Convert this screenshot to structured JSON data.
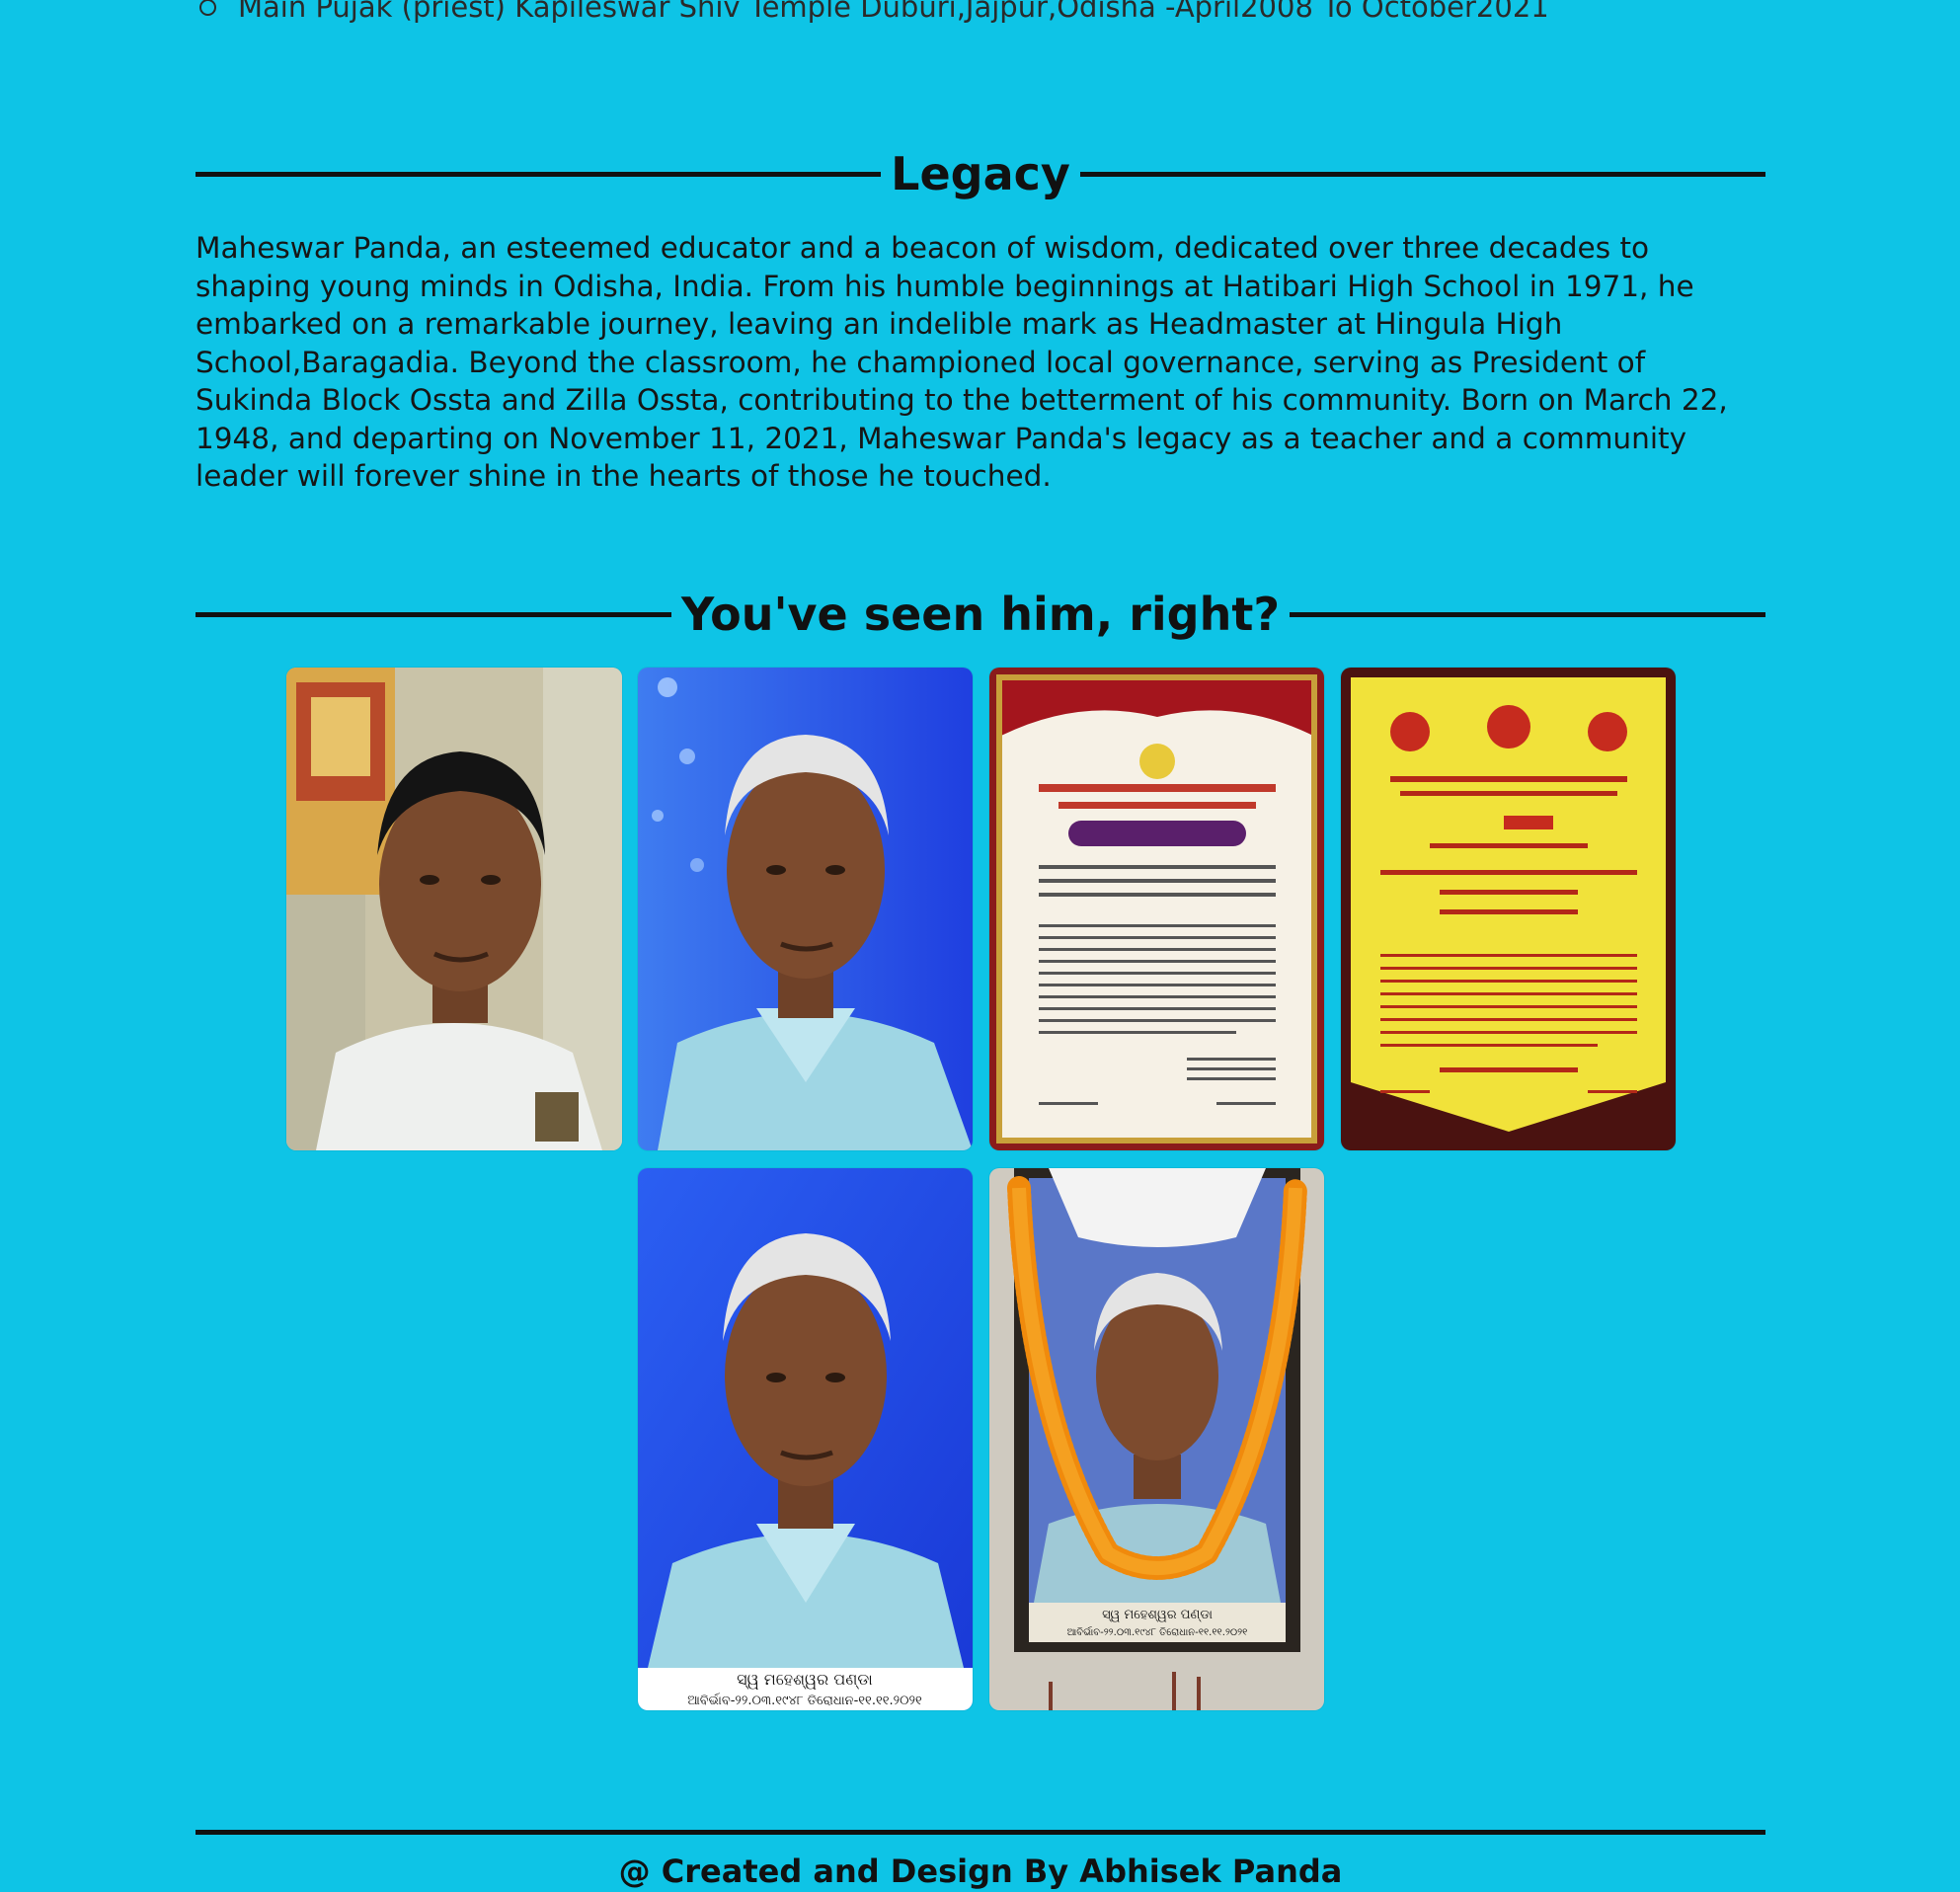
{
  "positions": {
    "last_item": "Main Pujak (priest) Kapileswar Shiv Temple Duburi,Jajpur,Odisha -April2008 To October2021"
  },
  "legacy": {
    "heading": "Legacy",
    "text": "Maheswar Panda, an esteemed educator and a beacon of wisdom, dedicated over three decades to shaping young minds in Odisha, India. From his humble beginnings at Hatibari High School in 1971, he embarked on a remarkable journey, leaving an indelible mark as Headmaster at Hingula High School,Baragadia. Beyond the classroom, he championed local governance, serving as President of Sukinda Block Ossta and Zilla Ossta, contributing to the betterment of his community. Born on March 22, 1948, and departing on November 11, 2021, Maheswar Panda's legacy as a teacher and a community leader will forever shine in the hearts of those he touched."
  },
  "gallery": {
    "heading": "You've seen him, right?",
    "photos": [
      {
        "name": "photo-portrait-indoor"
      },
      {
        "name": "photo-portrait-blue-bg"
      },
      {
        "name": "photo-felicitation-certificate"
      },
      {
        "name": "photo-brahmin-samaj-certificate"
      },
      {
        "name": "photo-memorial-portrait",
        "caption_line1": "ସ୍ୱ ମହେଶ୍ୱର ପଣ୍ଡା",
        "caption_line2": "ଆବିର୍ଭାବ-୨୨.୦୩.୧୯୪୮ ତିରୋଧାନ-୧୧.୧୧.୨୦୨୧"
      },
      {
        "name": "photo-garlanded-frame",
        "caption_line1": "ସ୍ୱ ମହେଶ୍ୱର ପଣ୍ଡା",
        "caption_line2": "ଆବିର୍ଭାବ-୨୨.୦୩.୧୯୪୮ ତିରୋଧାନ-୧୧.୧୧.୨୦୨୧"
      }
    ]
  },
  "footer": {
    "credit": "@ Created and Design By Abhisek Panda"
  },
  "colors": {
    "background": "#0ec4e6",
    "rule": "#111111"
  }
}
